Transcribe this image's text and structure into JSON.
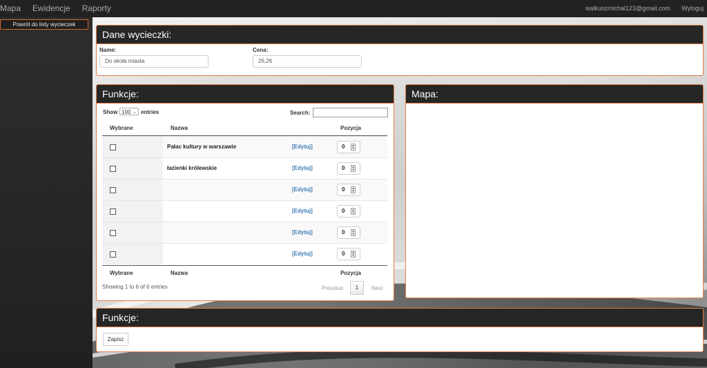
{
  "nav": {
    "left": [
      "Mapa",
      "Ewidencje",
      "Raporty"
    ],
    "user_email": "walkuszmichal123@gmail.com",
    "logout": "Wyloguj"
  },
  "sidebar": {
    "back_label": "Powrót do listy wycieczek"
  },
  "trip": {
    "title": "Dane wycieczki:",
    "name_label": "Name:",
    "name_value": "Do okoła miasta",
    "price_label": "Cena:",
    "price_value": "26,26"
  },
  "functions": {
    "title": "Funkcje:",
    "show_label": "Show",
    "show_value": "100",
    "entries_label": "entries",
    "search_label": "Search:",
    "columns": [
      "Wybrane",
      "Nazwa",
      "Pozycja"
    ],
    "rows": [
      {
        "name": "Pałac kultury w warszawie",
        "edit": "[Edytuj]",
        "position": "0"
      },
      {
        "name": "łazienki królewskie",
        "edit": "[Edytuj]",
        "position": "0"
      },
      {
        "name": "",
        "edit": "[Edytuj]",
        "position": "0"
      },
      {
        "name": "",
        "edit": "[Edytuj]",
        "position": "0"
      },
      {
        "name": "",
        "edit": "[Edytuj]",
        "position": "0"
      },
      {
        "name": "",
        "edit": "[Edytuj]",
        "position": "0"
      }
    ],
    "info": "Showing 1 to 6 of 6 entries",
    "pager": {
      "previous": "Previous",
      "current": "1",
      "next": "Next"
    }
  },
  "map": {
    "title": "Mapa:"
  },
  "save_section": {
    "title": "Funkcje:",
    "save_label": "Zapisz"
  },
  "colors": {
    "accent": "#e07b45",
    "header_bg": "#262626",
    "link": "#3a7bb5"
  }
}
